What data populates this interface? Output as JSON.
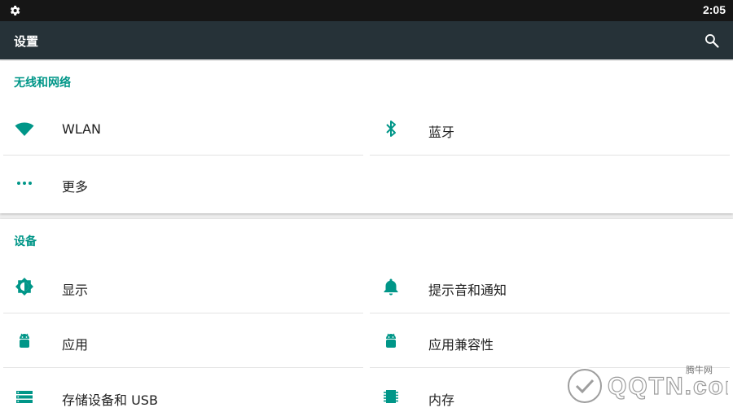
{
  "statusbar": {
    "time": "2:05",
    "left_icon": "android-debug-gear-icon"
  },
  "appbar": {
    "title": "设置",
    "search_icon": "search-icon"
  },
  "sections": {
    "wireless": {
      "title": "无线和网络",
      "items": {
        "wlan": {
          "label": "WLAN",
          "icon": "wifi-icon"
        },
        "bluetooth": {
          "label": "蓝牙",
          "icon": "bluetooth-icon"
        },
        "more": {
          "label": "更多",
          "icon": "more-horiz-icon"
        }
      }
    },
    "device": {
      "title": "设备",
      "items": {
        "display": {
          "label": "显示",
          "icon": "brightness-icon"
        },
        "sound": {
          "label": "提示音和通知",
          "icon": "bell-icon"
        },
        "apps": {
          "label": "应用",
          "icon": "android-icon"
        },
        "compat": {
          "label": "应用兼容性",
          "icon": "android-icon"
        },
        "storage": {
          "label": "存储设备和 USB",
          "icon": "storage-icon"
        },
        "memory": {
          "label": "内存",
          "icon": "memory-chip-icon"
        }
      }
    }
  },
  "watermark": {
    "site": "QQTN.com",
    "label": "腾牛网"
  },
  "colors": {
    "accent": "#009688",
    "appbar": "#263238",
    "statusbar": "#161616"
  }
}
